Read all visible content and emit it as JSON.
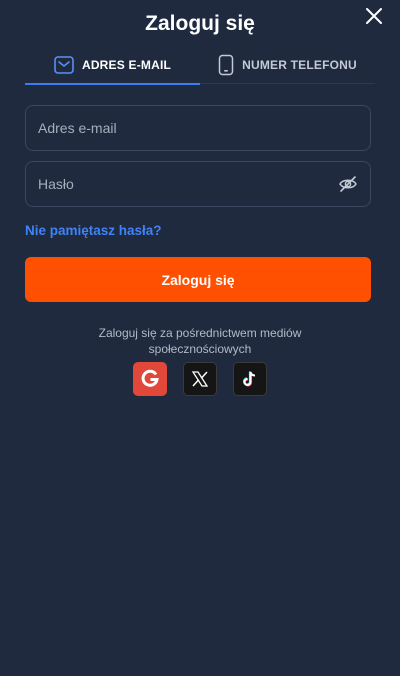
{
  "header": {
    "title": "Zaloguj się"
  },
  "tabs": [
    {
      "label": "ADRES E-MAIL",
      "icon": "envelope-icon",
      "active": true
    },
    {
      "label": "NUMER TELEFONU",
      "icon": "phone-icon",
      "active": false
    }
  ],
  "form": {
    "email_placeholder": "Adres e-mail",
    "email_value": "",
    "password_placeholder": "Hasło",
    "password_value": "",
    "forgot_label": "Nie pamiętasz hasła?",
    "submit_label": "Zaloguj się"
  },
  "social": {
    "caption": "Zaloguj się za pośrednictwem mediów społecznościowych",
    "providers": [
      "google-icon",
      "x-icon",
      "tiktok-icon"
    ]
  },
  "colors": {
    "background": "#1f2a3f",
    "accent_blue": "#3b7cf0",
    "primary_orange": "#ff4f00",
    "google_red": "#e2483a"
  }
}
